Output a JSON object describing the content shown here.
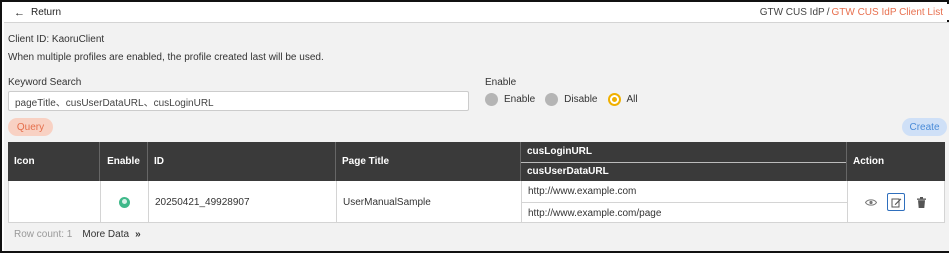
{
  "header": {
    "return_label": "Return",
    "breadcrumb": {
      "parent": "GTW CUS IdP",
      "separator": "/",
      "current": "GTW CUS IdP Client List"
    }
  },
  "client": {
    "id_text": "Client ID: KaoruClient",
    "note": "When multiple profiles are enabled, the profile created last will be used."
  },
  "search": {
    "label": "Keyword Search",
    "value": "pageTitle、cusUserDataURL、cusLoginURL",
    "placeholder": ""
  },
  "enable_filter": {
    "label": "Enable",
    "options": [
      "Enable",
      "Disable",
      "All"
    ],
    "selected": "All",
    "selected_color": "#f0b000"
  },
  "buttons": {
    "query": "Query",
    "create": "Create"
  },
  "table": {
    "headers": {
      "icon": "Icon",
      "enable": "Enable",
      "id": "ID",
      "page_title": "Page Title",
      "login_url": "cusLoginURL",
      "user_data_url": "cusUserDataURL",
      "action": "Action"
    },
    "rows": [
      {
        "icon": "",
        "enable": "enabled-status-icon",
        "id": "20250421_49928907",
        "page_title": "UserManualSample",
        "login_url": "http://www.example.com",
        "user_data_url": "http://www.example.com/page",
        "actions": [
          "eye-icon",
          "edit-icon",
          "trash-icon"
        ]
      }
    ]
  },
  "footer": {
    "row_count": "Row count: 1",
    "more_data": "More Data",
    "more_icon": "»"
  },
  "colors": {
    "accent": "#e8704f",
    "header_bg": "#3a3a3a",
    "status_green": "#3fb98a",
    "edit_border": "#2f6fbd"
  }
}
